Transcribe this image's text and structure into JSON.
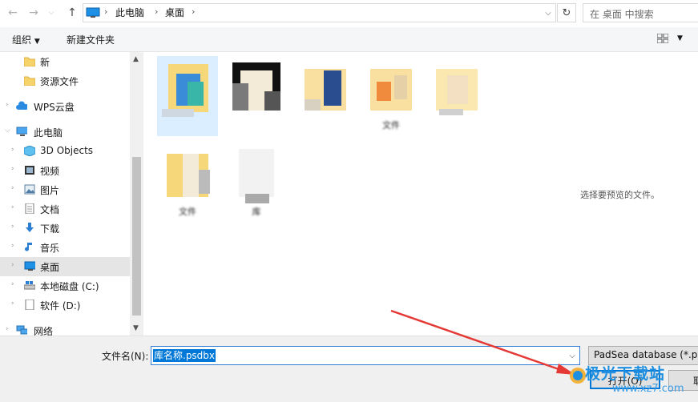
{
  "address": {
    "crumbs": [
      "此电脑",
      "桌面"
    ],
    "search_placeholder": "在 桌面 中搜索"
  },
  "toolbar": {
    "organize_label": "组织",
    "new_folder_label": "新建文件夹"
  },
  "nav": {
    "items": [
      {
        "label": "新",
        "icon": "folder-icon"
      },
      {
        "label": "资源文件",
        "icon": "folder-icon"
      },
      {
        "label": "WPS云盘",
        "icon": "cloud-icon"
      },
      {
        "label": "此电脑",
        "icon": "computer-icon"
      },
      {
        "label": "3D Objects",
        "icon": "cube-icon"
      },
      {
        "label": "视频",
        "icon": "video-icon"
      },
      {
        "label": "图片",
        "icon": "picture-icon"
      },
      {
        "label": "文档",
        "icon": "document-icon"
      },
      {
        "label": "下载",
        "icon": "download-icon"
      },
      {
        "label": "音乐",
        "icon": "music-icon"
      },
      {
        "label": "桌面",
        "icon": "desktop-icon"
      },
      {
        "label": "本地磁盘 (C:)",
        "icon": "drive-icon"
      },
      {
        "label": "软件 (D:)",
        "icon": "drive-icon"
      },
      {
        "label": "网络",
        "icon": "network-icon"
      }
    ]
  },
  "files": {
    "labels": [
      "",
      "",
      "",
      "文件",
      "",
      "",
      "文件",
      "库"
    ]
  },
  "preview": {
    "message": "选择要预览的文件。"
  },
  "bottom": {
    "filename_label": "文件名(N):",
    "filename_value": "库名称.psdbx",
    "filter_value": "PadSea database (*.ps",
    "open_label": "打开(O)",
    "cancel_label": "取"
  },
  "watermark": {
    "text": "极光下载站",
    "sub": "www.xz7.com"
  },
  "colors": {
    "accent": "#0078d7",
    "selection": "#cce8ff",
    "arrow": "#e53935"
  }
}
